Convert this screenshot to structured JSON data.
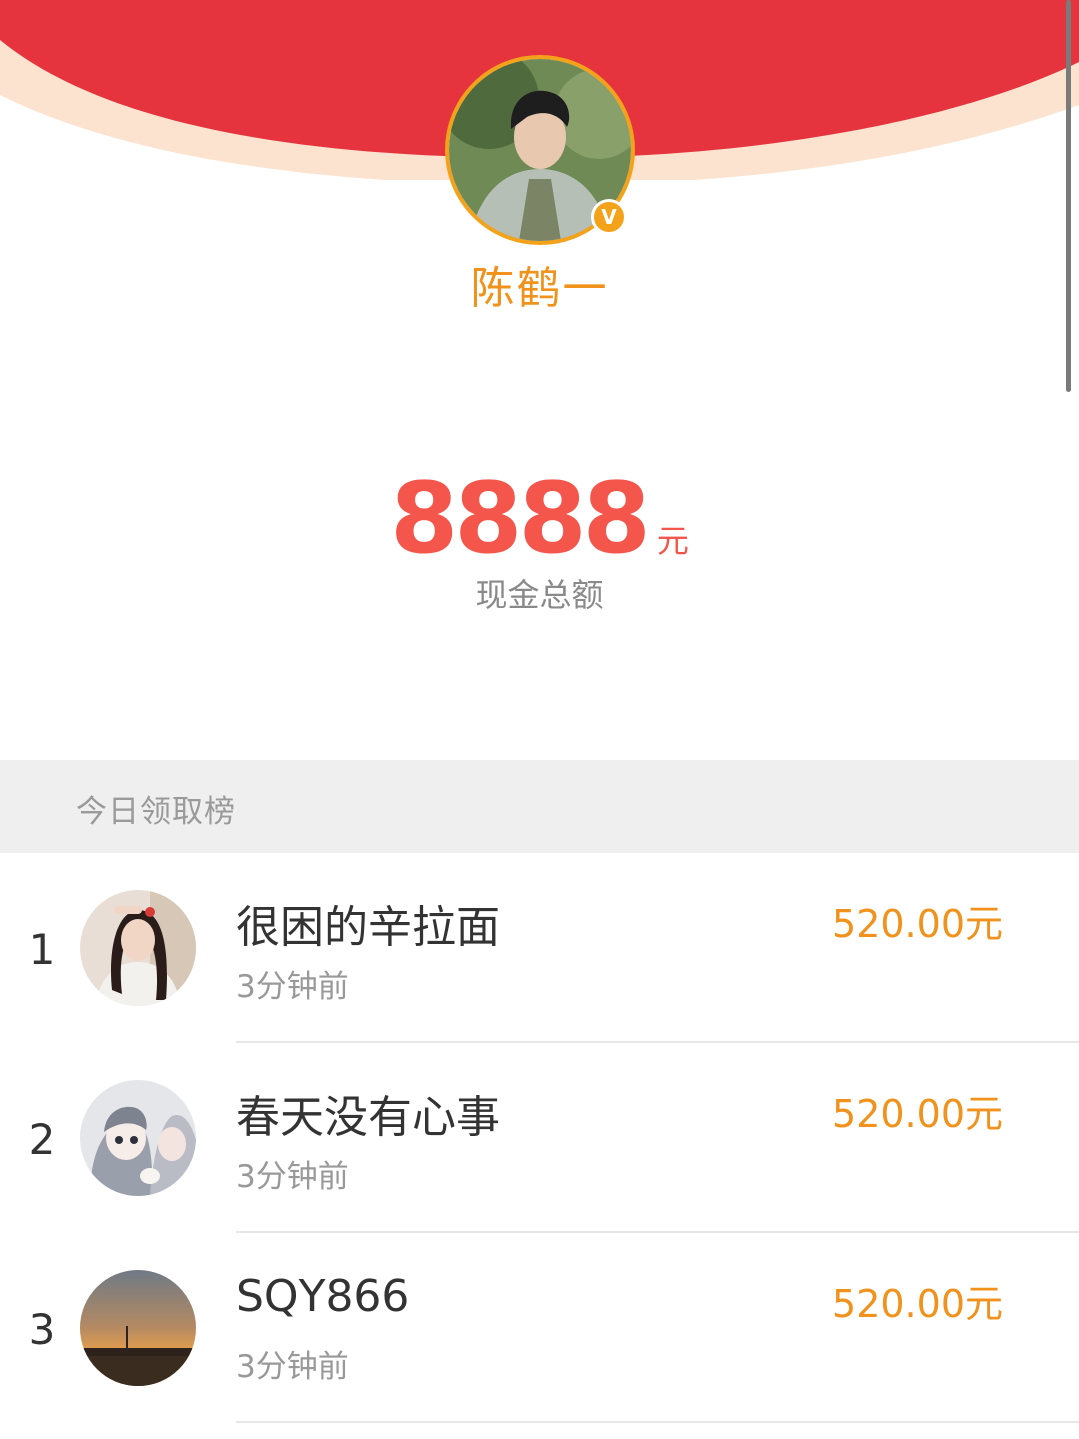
{
  "colors": {
    "envelope_red": "#e6343f",
    "envelope_rim": "#fbe3cf",
    "accent_orange": "#f0921b",
    "amount_red": "#f4564b",
    "section_gray": "#efefef"
  },
  "host": {
    "name": "陈鹤一",
    "verified_badge": "V",
    "avatar_icon": "profile-photo-icon"
  },
  "summary": {
    "amount": "8888",
    "unit": "元",
    "caption": "现金总额"
  },
  "leaderboard": {
    "title": "今日领取榜",
    "rows": [
      {
        "rank": "1",
        "name": "很困的辛拉面",
        "time": "3分钟前",
        "amount": "520.00元"
      },
      {
        "rank": "2",
        "name": "春天没有心事",
        "time": "3分钟前",
        "amount": "520.00元"
      },
      {
        "rank": "3",
        "name": "SQY866",
        "time": "3分钟前",
        "amount": "520.00元"
      }
    ]
  }
}
